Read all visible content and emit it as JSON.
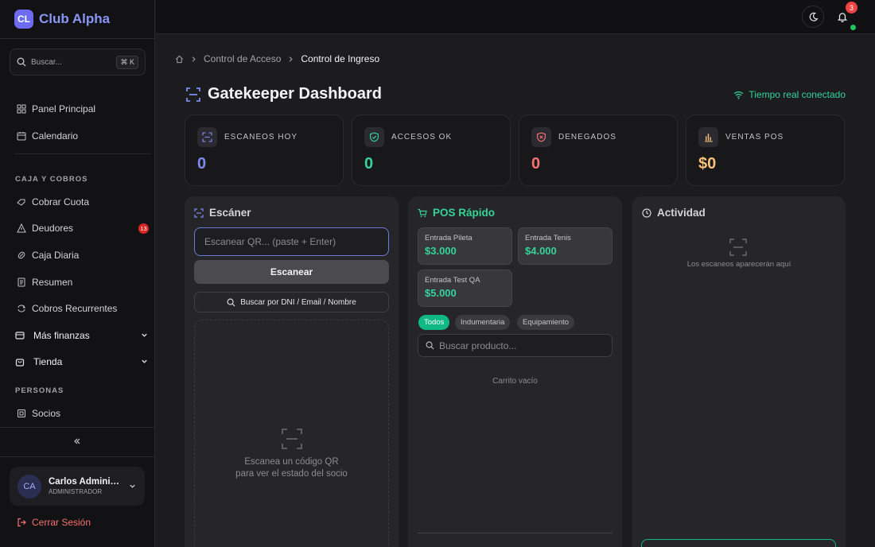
{
  "brand": {
    "logo": "CL",
    "name": "Club Alpha"
  },
  "sidebar": {
    "search_placeholder": "Buscar...",
    "search_shortcut": "⌘ K",
    "items_top": [
      {
        "label": "Panel Principal",
        "icon": "dashboard-icon"
      },
      {
        "label": "Calendario",
        "icon": "calendar-icon"
      }
    ],
    "section_caja": "CAJA Y COBROS",
    "items_caja": [
      {
        "label": "Cobrar Cuota",
        "icon": "coins-icon"
      },
      {
        "label": "Deudores",
        "icon": "alert-triangle-icon",
        "badge": "13"
      },
      {
        "label": "Caja Diaria",
        "icon": "wallet-icon"
      },
      {
        "label": "Resumen",
        "icon": "receipt-icon"
      },
      {
        "label": "Cobros Recurrentes",
        "icon": "repeat-icon"
      }
    ],
    "group_finanzas": "Más finanzas",
    "group_tienda": "Tienda",
    "section_personas": "PERSONAS",
    "item_socios": "Socios",
    "user": {
      "initials": "CA",
      "name": "Carlos Administrador",
      "role": "ADMINISTRADOR"
    },
    "logout": "Cerrar Sesión"
  },
  "topbar": {
    "notifications": "3"
  },
  "breadcrumb": [
    "Control de Acceso",
    "Control de Ingreso"
  ],
  "page": {
    "title": "Gatekeeper Dashboard",
    "realtime": "Tiempo real conectado"
  },
  "stats": [
    {
      "label": "ESCANEOS HOY",
      "value": "0",
      "color": "#7c8bf0",
      "icon": "scan-icon"
    },
    {
      "label": "ACCESOS OK",
      "value": "0",
      "color": "#34d399",
      "icon": "shield-check-icon"
    },
    {
      "label": "DENEGADOS",
      "value": "0",
      "color": "#f87171",
      "icon": "shield-x-icon"
    },
    {
      "label": "VENTAS POS",
      "value": "$0",
      "color": "#fbbf77",
      "icon": "bar-chart-icon"
    }
  ],
  "scanner": {
    "title": "Escáner",
    "input_placeholder": "Escanear QR... (paste + Enter)",
    "scan_button": "Escanear",
    "search_button": "Buscar por DNI / Email / Nombre",
    "empty_line1": "Escanea un código QR",
    "empty_line2": "para ver el estado del socio"
  },
  "pos": {
    "title": "POS Rápido",
    "products": [
      {
        "name": "Entrada Pileta",
        "price": "$3.000"
      },
      {
        "name": "Entrada Tenis",
        "price": "$4.000"
      },
      {
        "name": "Entrada Test QA",
        "price": "$5.000"
      }
    ],
    "filters": [
      "Todos",
      "Indumentaria",
      "Equipamiento"
    ],
    "search_placeholder": "Buscar producto...",
    "cart_empty": "Carrito vacío"
  },
  "activity": {
    "title": "Actividad",
    "empty": "Los escaneos aparecerán aquí"
  },
  "colors": {
    "accent": "#6d6cf0",
    "success": "#10b981",
    "danger": "#ef4444"
  }
}
